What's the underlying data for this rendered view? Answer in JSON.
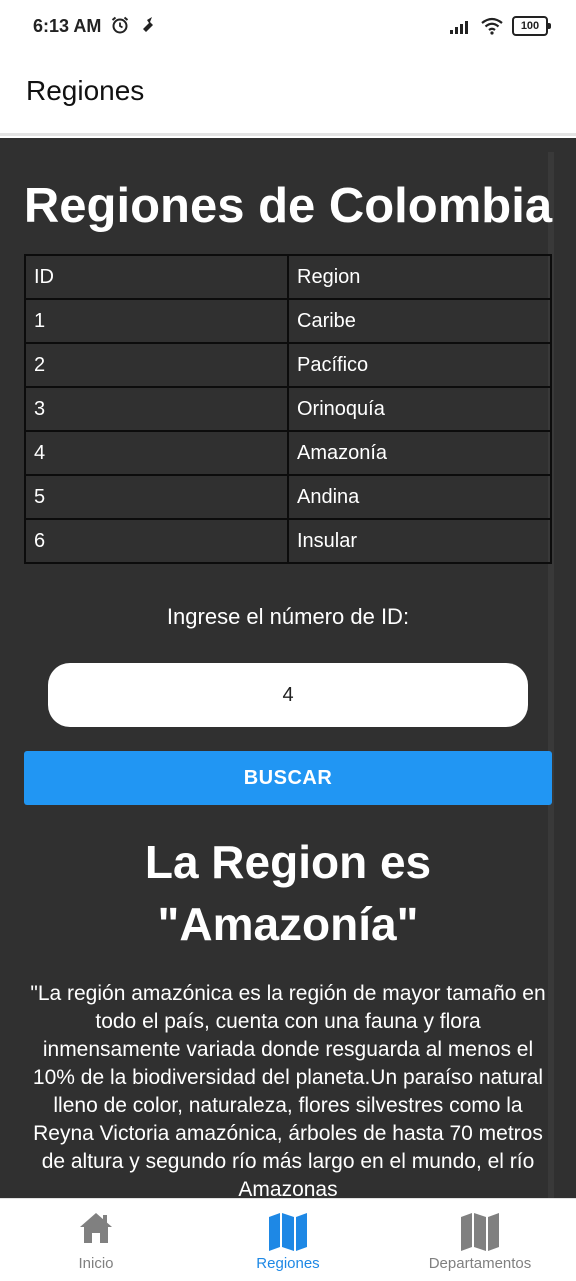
{
  "status_bar": {
    "time": "6:13 AM",
    "battery": "100"
  },
  "app_bar": {
    "title": "Regiones"
  },
  "main": {
    "title": "Regiones de Colombia",
    "table": {
      "headers": [
        "ID",
        "Region"
      ],
      "rows": [
        [
          "1",
          "Caribe"
        ],
        [
          "2",
          "Pacífico"
        ],
        [
          "3",
          "Orinoquía"
        ],
        [
          "4",
          "Amazonía"
        ],
        [
          "5",
          "Andina"
        ],
        [
          "6",
          "Insular"
        ]
      ]
    },
    "prompt": "Ingrese el número de ID:",
    "id_input_value": "4",
    "search_button": "BUSCAR",
    "result_title": "La Region es \"Amazonía\"",
    "result_description": "\"La región amazónica es la región de mayor tamaño en todo el país, cuenta con una fauna y flora inmensamente variada donde resguarda al menos el 10% de la biodiversidad del planeta.Un paraíso natural lleno de color, naturaleza, flores silvestres como la Reyna Victoria amazónica, árboles de hasta 70 metros de altura y segundo río más largo en el mundo, el río Amazonas"
  },
  "bottom_nav": {
    "items": [
      {
        "label": "Inicio",
        "icon": "home-icon",
        "active": false
      },
      {
        "label": "Regiones",
        "icon": "map-icon",
        "active": true
      },
      {
        "label": "Departamentos",
        "icon": "map-icon",
        "active": false
      }
    ]
  },
  "colors": {
    "content_background": "#303030",
    "accent": "#2196f3",
    "active_nav": "#1e88e5",
    "inactive_nav": "#808080"
  }
}
